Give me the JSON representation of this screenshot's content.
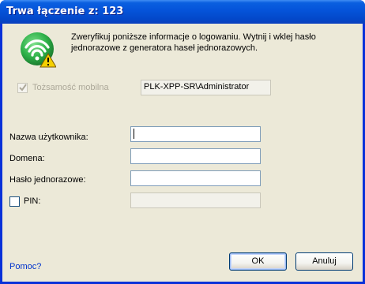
{
  "window": {
    "title": "Trwa łączenie z: 123"
  },
  "intro": {
    "line1": "Zweryfikuj poniższe informacje o logowaniu. Wytnij i wklej hasło",
    "line2": "jednorazowe z generatora haseł jednorazowych."
  },
  "identity": {
    "checkbox_label": "Tożsamość mobilna",
    "checked": true,
    "enabled": false,
    "value": "PLK-XPP-SR\\Administrator"
  },
  "form": {
    "username_label": "Nazwa użytkownika:",
    "username_value": "",
    "domain_label": "Domena:",
    "domain_value": "",
    "otp_label": "Hasło jednorazowe:",
    "otp_value": "",
    "pin_label": "PIN:",
    "pin_checked": false,
    "pin_value": ""
  },
  "footer": {
    "help_link": "Pomoc?",
    "ok_label": "OK",
    "cancel_label": "Anuluj"
  },
  "colors": {
    "titlebar": "#0553d9",
    "dialog_bg": "#ece9d8",
    "link": "#0033cc",
    "icon_green": "#2fb24a",
    "warning_yellow": "#f5d000"
  },
  "icons": {
    "main": "wireless-warning-icon",
    "checkmark": "checkmark-icon"
  }
}
